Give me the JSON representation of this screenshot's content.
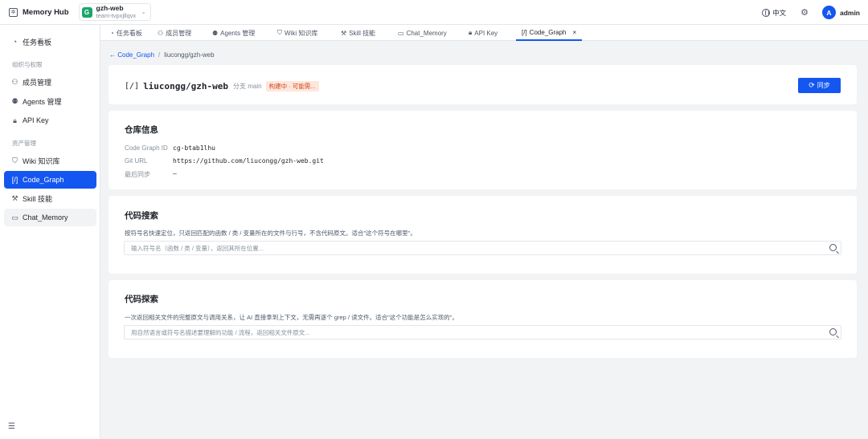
{
  "app": {
    "name": "Memory Hub"
  },
  "team": {
    "avatar": "G",
    "name": "gzh-web",
    "id": "team-tvpxjllqvx"
  },
  "header": {
    "language": "中文",
    "user_avatar": "A",
    "user_name": "admin"
  },
  "sidebar": {
    "items": [
      {
        "key": "task-board",
        "label": "任务看板",
        "icon": "dashboard-icon"
      },
      {
        "key": "members",
        "label": "成员管理",
        "icon": "user-icon"
      },
      {
        "key": "agents",
        "label": "Agents 管理",
        "icon": "users-icon"
      },
      {
        "key": "api-key",
        "label": "API Key",
        "icon": "lock-icon"
      },
      {
        "key": "wiki",
        "label": "Wiki 知识库",
        "icon": "bookmark-icon"
      },
      {
        "key": "code-graph",
        "label": "Code_Graph",
        "icon": "code-icon"
      },
      {
        "key": "skill",
        "label": "Skill 技能",
        "icon": "tools-icon"
      },
      {
        "key": "chat-memory",
        "label": "Chat_Memory",
        "icon": "chat-icon"
      }
    ],
    "groups": {
      "org": "组织与权限",
      "assets": "资产管理"
    }
  },
  "tabs": [
    {
      "label": "任务看板",
      "icon": "dashboard-icon"
    },
    {
      "label": "成员管理",
      "icon": "user-icon"
    },
    {
      "label": "Agents 管理",
      "icon": "users-icon"
    },
    {
      "label": "Wiki 知识库",
      "icon": "bookmark-icon"
    },
    {
      "label": "Skill 技能",
      "icon": "tools-icon"
    },
    {
      "label": "Chat_Memory",
      "icon": "chat-icon"
    },
    {
      "label": "API Key",
      "icon": "lock-icon"
    },
    {
      "label": "Code_Graph",
      "icon": "code-icon",
      "active": true
    }
  ],
  "breadcrumb": {
    "back": "← Code_Graph",
    "separator": "/",
    "current": "liucongg/gzh-web"
  },
  "repo": {
    "icon_text": "[/]",
    "name": "liucongg/gzh-web",
    "branch": "分支 main",
    "status": "构建中 · 可能需...",
    "sync_label": "同步"
  },
  "repo_info": {
    "title": "仓库信息",
    "rows": [
      {
        "label": "Code Graph ID",
        "value": "cg-btab1lhu"
      },
      {
        "label": "Git URL",
        "value": "https://github.com/liucongg/gzh-web.git"
      },
      {
        "label": "最后同步",
        "value": "—"
      }
    ]
  },
  "code_search": {
    "title": "代码搜索",
    "description": "按符号名快速定位，只返回匹配的函数 / 类 / 变量所在的文件与行号，不含代码原文。适合\"这个符号在哪里\"。",
    "placeholder": "输入符号名（函数 / 类 / 变量），返回其所在位置..."
  },
  "code_explore": {
    "title": "代码探索",
    "description": "一次返回相关文件的完整原文与调用关系，让 AI 直接拿到上下文，无需再逐个 grep / 读文件。适合\"这个功能是怎么实现的\"。",
    "placeholder": "用自然语言或符号名描述要理解的功能 / 流程，返回相关文件原文..."
  },
  "colors": {
    "accent": "#1456f0",
    "team": "#1aa56a",
    "badge_bg": "#fde7dc",
    "badge_fg": "#d2481c"
  }
}
